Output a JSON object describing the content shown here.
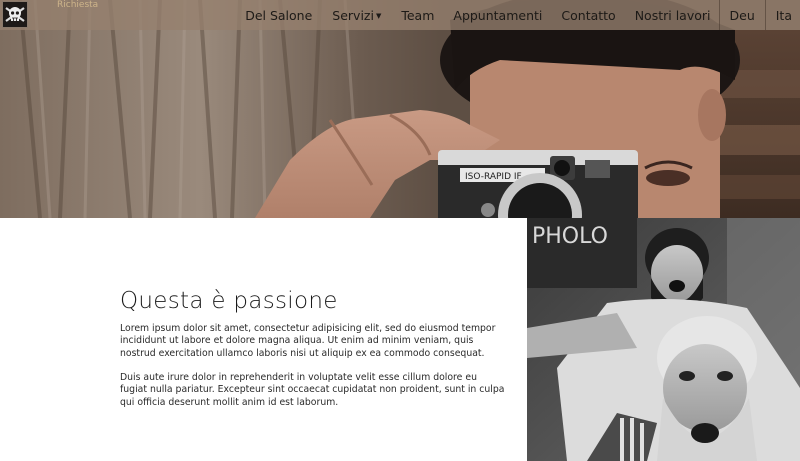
{
  "navbar": {
    "logo_text": "Richiesta",
    "items": [
      {
        "label": "Del Salone"
      },
      {
        "label": "Servizi",
        "has_dropdown": true
      },
      {
        "label": "Team"
      },
      {
        "label": "Appuntamenti"
      },
      {
        "label": "Contatto"
      },
      {
        "label": "Nostri lavori"
      }
    ],
    "languages": [
      "Deu",
      "Ita"
    ]
  },
  "hero": {
    "camera_label": "ISO-RAPID IF"
  },
  "about": {
    "title": "Questa è passione",
    "paragraph1": "Lorem ipsum dolor sit amet, consectetur adipisicing elit, sed do eiusmod tempor incididunt ut labore et dolore magna aliqua. Ut enim ad minim veniam, quis nostrud exercitation ullamco laboris nisi ut aliquip ex ea commodo consequat.",
    "paragraph2": "Duis aute irure dolor in reprehenderit in voluptate velit esse cillum dolore eu fugiat nulla pariatur. Excepteur sint occaecat cupidatat non proident, sunt in culpa qui officia deserunt mollit anim id est laborum."
  },
  "photo": {
    "sign_text": "PHOLO"
  },
  "colors": {
    "navbar_bg": "#96806e",
    "nav_text": "#1d1a17",
    "logo_text": "#cdb48a",
    "body_text": "#2a2a2a"
  }
}
